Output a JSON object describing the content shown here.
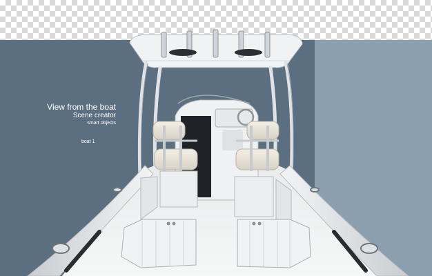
{
  "caption": {
    "title": "View from the boat",
    "subtitle": "Scene creator",
    "small": "smart objects"
  },
  "tag": "boat 1",
  "colors": {
    "left_panel": "#5c6f80",
    "right_panel": "#8c9fae",
    "hull": "#eef0f1",
    "checker": "#d9d9d9"
  }
}
